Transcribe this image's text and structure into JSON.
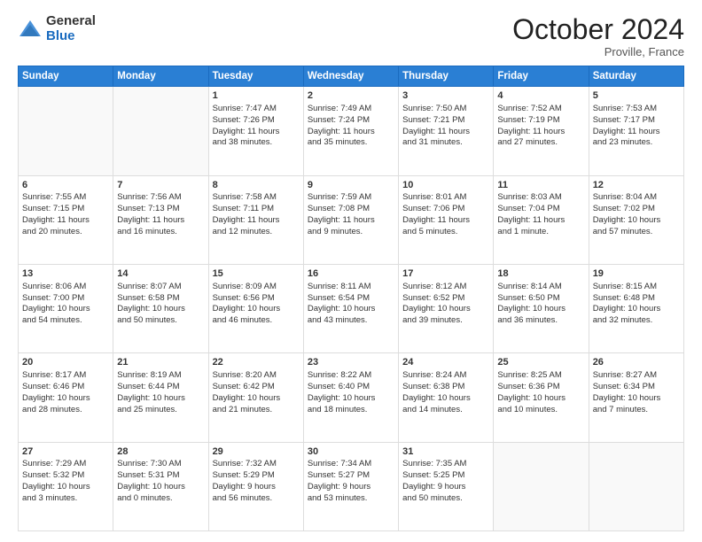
{
  "header": {
    "logo_general": "General",
    "logo_blue": "Blue",
    "month_title": "October 2024",
    "location": "Proville, France"
  },
  "weekdays": [
    "Sunday",
    "Monday",
    "Tuesday",
    "Wednesday",
    "Thursday",
    "Friday",
    "Saturday"
  ],
  "weeks": [
    [
      {
        "day": "",
        "lines": []
      },
      {
        "day": "",
        "lines": []
      },
      {
        "day": "1",
        "lines": [
          "Sunrise: 7:47 AM",
          "Sunset: 7:26 PM",
          "Daylight: 11 hours",
          "and 38 minutes."
        ]
      },
      {
        "day": "2",
        "lines": [
          "Sunrise: 7:49 AM",
          "Sunset: 7:24 PM",
          "Daylight: 11 hours",
          "and 35 minutes."
        ]
      },
      {
        "day": "3",
        "lines": [
          "Sunrise: 7:50 AM",
          "Sunset: 7:21 PM",
          "Daylight: 11 hours",
          "and 31 minutes."
        ]
      },
      {
        "day": "4",
        "lines": [
          "Sunrise: 7:52 AM",
          "Sunset: 7:19 PM",
          "Daylight: 11 hours",
          "and 27 minutes."
        ]
      },
      {
        "day": "5",
        "lines": [
          "Sunrise: 7:53 AM",
          "Sunset: 7:17 PM",
          "Daylight: 11 hours",
          "and 23 minutes."
        ]
      }
    ],
    [
      {
        "day": "6",
        "lines": [
          "Sunrise: 7:55 AM",
          "Sunset: 7:15 PM",
          "Daylight: 11 hours",
          "and 20 minutes."
        ]
      },
      {
        "day": "7",
        "lines": [
          "Sunrise: 7:56 AM",
          "Sunset: 7:13 PM",
          "Daylight: 11 hours",
          "and 16 minutes."
        ]
      },
      {
        "day": "8",
        "lines": [
          "Sunrise: 7:58 AM",
          "Sunset: 7:11 PM",
          "Daylight: 11 hours",
          "and 12 minutes."
        ]
      },
      {
        "day": "9",
        "lines": [
          "Sunrise: 7:59 AM",
          "Sunset: 7:08 PM",
          "Daylight: 11 hours",
          "and 9 minutes."
        ]
      },
      {
        "day": "10",
        "lines": [
          "Sunrise: 8:01 AM",
          "Sunset: 7:06 PM",
          "Daylight: 11 hours",
          "and 5 minutes."
        ]
      },
      {
        "day": "11",
        "lines": [
          "Sunrise: 8:03 AM",
          "Sunset: 7:04 PM",
          "Daylight: 11 hours",
          "and 1 minute."
        ]
      },
      {
        "day": "12",
        "lines": [
          "Sunrise: 8:04 AM",
          "Sunset: 7:02 PM",
          "Daylight: 10 hours",
          "and 57 minutes."
        ]
      }
    ],
    [
      {
        "day": "13",
        "lines": [
          "Sunrise: 8:06 AM",
          "Sunset: 7:00 PM",
          "Daylight: 10 hours",
          "and 54 minutes."
        ]
      },
      {
        "day": "14",
        "lines": [
          "Sunrise: 8:07 AM",
          "Sunset: 6:58 PM",
          "Daylight: 10 hours",
          "and 50 minutes."
        ]
      },
      {
        "day": "15",
        "lines": [
          "Sunrise: 8:09 AM",
          "Sunset: 6:56 PM",
          "Daylight: 10 hours",
          "and 46 minutes."
        ]
      },
      {
        "day": "16",
        "lines": [
          "Sunrise: 8:11 AM",
          "Sunset: 6:54 PM",
          "Daylight: 10 hours",
          "and 43 minutes."
        ]
      },
      {
        "day": "17",
        "lines": [
          "Sunrise: 8:12 AM",
          "Sunset: 6:52 PM",
          "Daylight: 10 hours",
          "and 39 minutes."
        ]
      },
      {
        "day": "18",
        "lines": [
          "Sunrise: 8:14 AM",
          "Sunset: 6:50 PM",
          "Daylight: 10 hours",
          "and 36 minutes."
        ]
      },
      {
        "day": "19",
        "lines": [
          "Sunrise: 8:15 AM",
          "Sunset: 6:48 PM",
          "Daylight: 10 hours",
          "and 32 minutes."
        ]
      }
    ],
    [
      {
        "day": "20",
        "lines": [
          "Sunrise: 8:17 AM",
          "Sunset: 6:46 PM",
          "Daylight: 10 hours",
          "and 28 minutes."
        ]
      },
      {
        "day": "21",
        "lines": [
          "Sunrise: 8:19 AM",
          "Sunset: 6:44 PM",
          "Daylight: 10 hours",
          "and 25 minutes."
        ]
      },
      {
        "day": "22",
        "lines": [
          "Sunrise: 8:20 AM",
          "Sunset: 6:42 PM",
          "Daylight: 10 hours",
          "and 21 minutes."
        ]
      },
      {
        "day": "23",
        "lines": [
          "Sunrise: 8:22 AM",
          "Sunset: 6:40 PM",
          "Daylight: 10 hours",
          "and 18 minutes."
        ]
      },
      {
        "day": "24",
        "lines": [
          "Sunrise: 8:24 AM",
          "Sunset: 6:38 PM",
          "Daylight: 10 hours",
          "and 14 minutes."
        ]
      },
      {
        "day": "25",
        "lines": [
          "Sunrise: 8:25 AM",
          "Sunset: 6:36 PM",
          "Daylight: 10 hours",
          "and 10 minutes."
        ]
      },
      {
        "day": "26",
        "lines": [
          "Sunrise: 8:27 AM",
          "Sunset: 6:34 PM",
          "Daylight: 10 hours",
          "and 7 minutes."
        ]
      }
    ],
    [
      {
        "day": "27",
        "lines": [
          "Sunrise: 7:29 AM",
          "Sunset: 5:32 PM",
          "Daylight: 10 hours",
          "and 3 minutes."
        ]
      },
      {
        "day": "28",
        "lines": [
          "Sunrise: 7:30 AM",
          "Sunset: 5:31 PM",
          "Daylight: 10 hours",
          "and 0 minutes."
        ]
      },
      {
        "day": "29",
        "lines": [
          "Sunrise: 7:32 AM",
          "Sunset: 5:29 PM",
          "Daylight: 9 hours",
          "and 56 minutes."
        ]
      },
      {
        "day": "30",
        "lines": [
          "Sunrise: 7:34 AM",
          "Sunset: 5:27 PM",
          "Daylight: 9 hours",
          "and 53 minutes."
        ]
      },
      {
        "day": "31",
        "lines": [
          "Sunrise: 7:35 AM",
          "Sunset: 5:25 PM",
          "Daylight: 9 hours",
          "and 50 minutes."
        ]
      },
      {
        "day": "",
        "lines": []
      },
      {
        "day": "",
        "lines": []
      }
    ]
  ]
}
